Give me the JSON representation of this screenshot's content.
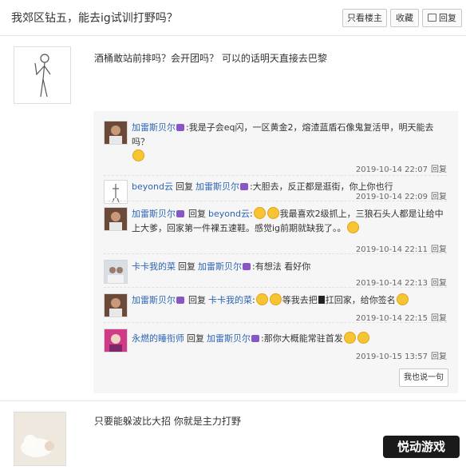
{
  "header": {
    "title": "我郊区钻五，能去ig试训打野吗？",
    "only_op_label": "只看楼主",
    "favorite_label": "收藏",
    "reply_label": "回复"
  },
  "post1": {
    "text": "酒桶敢站前排吗？会开团吗？ 可以的话明天直接去巴黎"
  },
  "comments": {
    "items": [
      {
        "user": "加雷斯贝尔",
        "reply_word": "",
        "target": "",
        "text": ":我是子会eq闪，一区黄金2，熔渣蓝盾石像鬼复活甲，明天能去吗？",
        "time": "2019-10-14 22:07",
        "reply_label": "回复"
      },
      {
        "user": "beyond云",
        "reply_word": "回复",
        "target": "加雷斯贝尔",
        "text": ":大胆去，反正都是逛街，你上你也行",
        "time": "2019-10-14 22:09",
        "reply_label": "回复"
      },
      {
        "user": "加雷斯贝尔",
        "reply_word": "回复",
        "target": "beyond云",
        "text": ":",
        "text2": "我最喜欢2级抓上，三狼石头人都是让给中上大爹，回家第一件裸五速鞋。感觉ig前期就缺我了。。",
        "time": "2019-10-14 22:11",
        "reply_label": "回复"
      },
      {
        "user": "卡卡我的菜",
        "reply_word": "回复",
        "target": "加雷斯贝尔",
        "text": ":有想法 看好你",
        "time": "2019-10-14 22:13",
        "reply_label": "回复"
      },
      {
        "user": "加雷斯贝尔",
        "reply_word": "回复",
        "target": "卡卡我的菜",
        "text": ":",
        "text2": "等我去把",
        "text3": "扛回家，给你签名",
        "time": "2019-10-14 22:15",
        "reply_label": "回复"
      },
      {
        "user": "永燃的睡衔师",
        "reply_word": "回复",
        "target": "加雷斯贝尔",
        "text": ":那你大概能常驻首发",
        "time": "2019-10-15 13:57",
        "reply_label": "回复"
      }
    ],
    "say_button": "我也说一句"
  },
  "post2": {
    "text": "只要能躲波比大招 你就是主力打野"
  },
  "watermark": "悦动游戏"
}
